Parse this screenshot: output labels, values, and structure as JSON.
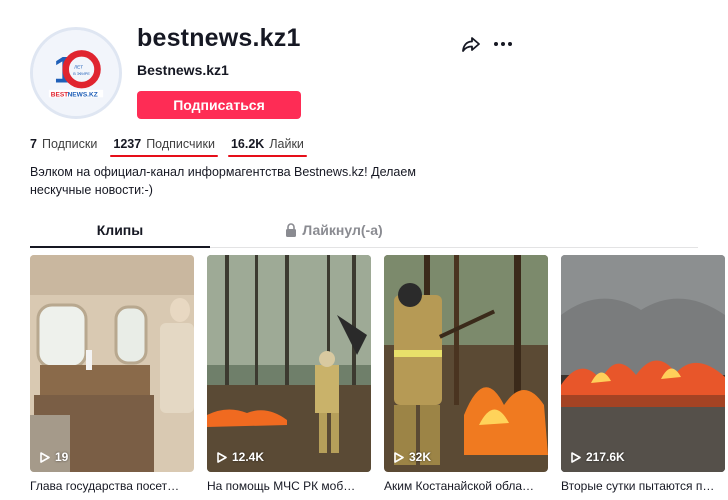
{
  "profile": {
    "username": "bestnews.kz1",
    "nickname": "Bestnews.kz1",
    "follow_label": "Подписаться",
    "avatar_icon": "bestnews-logo",
    "brand_color": "#fe2c55"
  },
  "stats": [
    {
      "value": "7",
      "label": "Подписки",
      "underlined": false
    },
    {
      "value": "1237",
      "label": "Подписчики",
      "underlined": true
    },
    {
      "value": "16.2K",
      "label": "Лайки",
      "underlined": true
    }
  ],
  "bio": "Вэлком на официал-канал информагентства Bestnews.kz! Делаем нескучные новости:-)",
  "tabs": [
    {
      "label": "Клипы",
      "active": true
    },
    {
      "label": "Лайкнул(-а)",
      "active": false,
      "icon": "lock-icon"
    }
  ],
  "videos": [
    {
      "views": "19",
      "caption": "Глава государства посет…"
    },
    {
      "views": "12.4K",
      "caption": "На помощь МЧС РК моб…"
    },
    {
      "views": "32K",
      "caption": "Аким Костанайской обла…"
    },
    {
      "views": "217.6K",
      "caption": "Вторые сутки пытаются п…"
    }
  ],
  "icons": {
    "share": "share-icon",
    "more": "more-icon",
    "play": "play-icon"
  }
}
